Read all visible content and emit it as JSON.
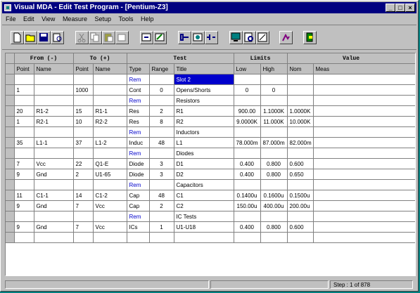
{
  "window": {
    "title": "Visual MDA - Edit Test Program - [Pentium-Z3]"
  },
  "menu": [
    "File",
    "Edit",
    "View",
    "Measure",
    "Setup",
    "Tools",
    "Help"
  ],
  "toolbar": [
    "new",
    "open",
    "save",
    "print-preview",
    "cut",
    "copy",
    "paste",
    "undo",
    "insert-row",
    "edit-step",
    "run",
    "measure",
    "compile",
    "monitor",
    "zoom",
    "learn",
    "test",
    "exit"
  ],
  "table": {
    "group_headers": [
      "From (-)",
      "To (+)",
      "Test",
      "Limits",
      "Value"
    ],
    "columns": [
      "Point",
      "Name",
      "Point",
      "Name",
      "Type",
      "Range",
      "Title",
      "Low",
      "High",
      "Nom",
      "Meas"
    ],
    "rows": [
      [
        "",
        "",
        "",
        "",
        "Rem",
        "",
        "Slot 2",
        "",
        "",
        "",
        ""
      ],
      [
        "1",
        "",
        "1000",
        "",
        "Cont",
        "0",
        "Opens/Shorts",
        "0",
        "0",
        "",
        ""
      ],
      [
        "",
        "",
        "",
        "",
        "Rem",
        "",
        "Resistors",
        "",
        "",
        "",
        ""
      ],
      [
        "20",
        "R1-2",
        "15",
        "R1-1",
        "Res",
        "2",
        "R1",
        "900.00",
        "1.1000K",
        "1.0000K",
        ""
      ],
      [
        "1",
        "R2-1",
        "10",
        "R2-2",
        "Res",
        "8",
        "R2",
        "9.0000K",
        "11.000K",
        "10.000K",
        ""
      ],
      [
        "",
        "",
        "",
        "",
        "Rem",
        "",
        "Inductors",
        "",
        "",
        "",
        ""
      ],
      [
        "35",
        "L1-1",
        "37",
        "L1-2",
        "Induc",
        "48",
        "L1",
        "78.000m",
        "87.000m",
        "82.000m",
        ""
      ],
      [
        "",
        "",
        "",
        "",
        "Rem",
        "",
        "Diodes",
        "",
        "",
        "",
        ""
      ],
      [
        "7",
        "Vcc",
        "22",
        "Q1-E",
        "Diode",
        "3",
        "D1",
        "0.400",
        "0.800",
        "0.600",
        ""
      ],
      [
        "9",
        "Gnd",
        "2",
        "U1-65",
        "Diode",
        "3",
        "D2",
        "0.400",
        "0.800",
        "0.650",
        ""
      ],
      [
        "",
        "",
        "",
        "",
        "Rem",
        "",
        "Capacitors",
        "",
        "",
        "",
        ""
      ],
      [
        "11",
        "C1-1",
        "14",
        "C1-2",
        "Cap",
        "48",
        "C1",
        "0.1400u",
        "0.1600u",
        "0.1500u",
        ""
      ],
      [
        "9",
        "Gnd",
        "7",
        "Vcc",
        "Cap",
        "2",
        "C2",
        "150.00u",
        "400.00u",
        "200.00u",
        ""
      ],
      [
        "",
        "",
        "",
        "",
        "Rem",
        "",
        "IC Tests",
        "",
        "",
        "",
        ""
      ],
      [
        "9",
        "Gnd",
        "7",
        "Vcc",
        "ICs",
        "1",
        "U1-U18",
        "0.400",
        "0.800",
        "0.600",
        ""
      ],
      [
        "",
        "",
        "",
        "",
        "",
        "",
        "",
        "",
        "",
        "",
        ""
      ]
    ]
  },
  "status": {
    "step": "Step : 1 of 878"
  }
}
